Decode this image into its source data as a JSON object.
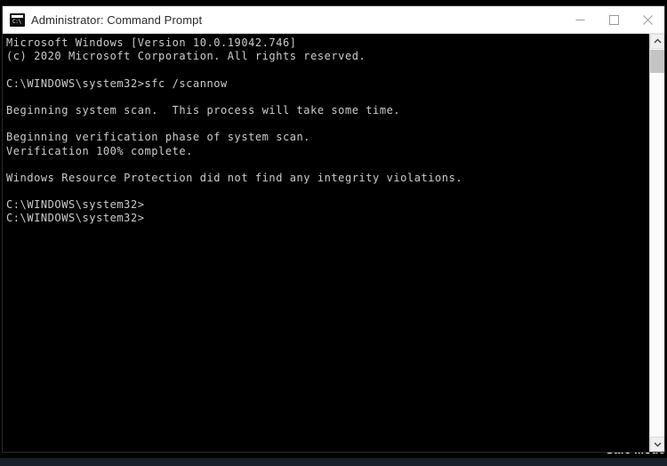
{
  "window": {
    "title": "Administrator: Command Prompt",
    "icon_name": "cmd-icon",
    "icon_glyph": "C:\\",
    "controls": {
      "minimize_label": "Minimize",
      "maximize_label": "Maximize",
      "close_label": "Close"
    }
  },
  "terminal": {
    "lines": [
      "Microsoft Windows [Version 10.0.19042.746]",
      "(c) 2020 Microsoft Corporation. All rights reserved.",
      "",
      "C:\\WINDOWS\\system32>sfc /scannow",
      "",
      "Beginning system scan.  This process will take some time.",
      "",
      "Beginning verification phase of system scan.",
      "Verification 100% complete.",
      "",
      "Windows Resource Protection did not find any integrity violations.",
      "",
      "C:\\WINDOWS\\system32>",
      "C:\\WINDOWS\\system32>"
    ],
    "foreground_color": "#cccccc",
    "background_color": "#000000"
  },
  "scrollbar": {
    "up_arrow_name": "scroll-up-arrow",
    "down_arrow_name": "scroll-down-arrow",
    "thumb_name": "scrollbar-thumb"
  },
  "desktop": {
    "safe_mode_watermark": "Safe Mode",
    "background_color": "#000000",
    "strip_color": "#1b212b"
  }
}
